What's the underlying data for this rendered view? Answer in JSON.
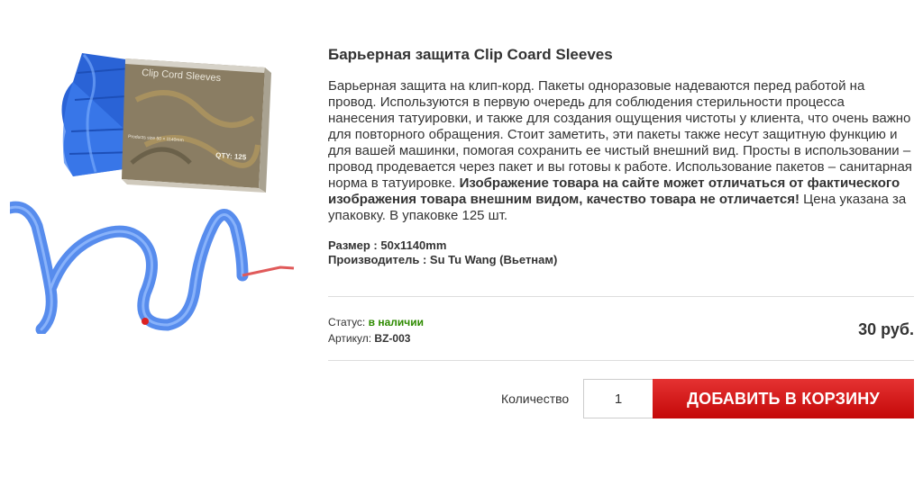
{
  "product": {
    "title": "Барьерная защита Clip Coard Sleeves",
    "image_alt": "Clip Cord Sleeves",
    "box_label": "Clip Cord Sleeves",
    "box_size_text": "Products size 50 × 1140mm",
    "box_qty_text": "QTY: 125",
    "description_part1": "Барьерная защита на клип-корд. Пакеты одноразовые надеваются перед работой на провод. Используются в первую очередь для соблюдения стерильности процесса нанесения татуировки, и также для создания ощущения чистоты у клиента, что очень важно для повторного обращения. Стоит заметить, эти пакеты также несут защитную функцию и для вашей машинки, помогая сохранить ее чистый внешний вид. Просты в использовании – провод продевается через пакет и вы готовы к работе. Использование пакетов – санитарная норма в татуировке. ",
    "description_bold": "Изображение товара на сайте может отличаться от фактического изображения товара внешним видом, качество товара не отличается!",
    "description_part2": " Цена указана за упаковку. В упаковке 125 шт.",
    "size_line": "Размер : 50x1140mm",
    "manufacturer_line": "Производитель : Su Tu Wang (Вьетнам)",
    "status_label": "Статус:",
    "status_value": "в наличии",
    "sku_label": "Артикул:",
    "sku_value": "BZ-003",
    "price": "30 руб."
  },
  "cart": {
    "qty_label": "Количество",
    "qty_value": "1",
    "add_button_label": "ДОБАВИТЬ В КОРЗИНУ"
  },
  "colors": {
    "accent_red": "#d71a1a",
    "status_green": "#2e8b00",
    "sleeve_blue": "#2f6fe0"
  }
}
